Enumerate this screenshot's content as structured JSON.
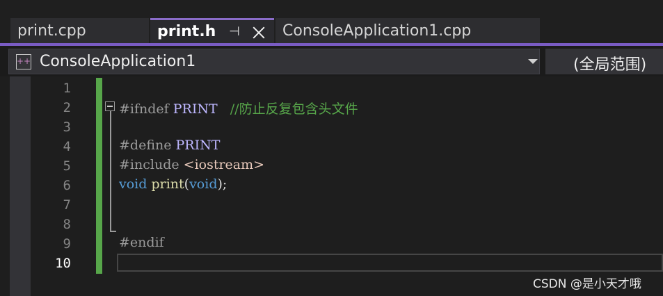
{
  "tabs": [
    {
      "label": "print.cpp"
    },
    {
      "label": "print.h"
    },
    {
      "label": "ConsoleApplication1.cpp"
    }
  ],
  "navbar": {
    "project": "ConsoleApplication1",
    "scope": "(全局范围)"
  },
  "editor": {
    "line_numbers": [
      "1",
      "2",
      "3",
      "4",
      "5",
      "6",
      "7",
      "8",
      "9",
      "10"
    ],
    "current_line": 10,
    "code": {
      "l2_directive": "#ifndef",
      "l2_macro": " PRINT",
      "l2_comment": "   //防止反复包含头文件",
      "l4_directive": "#define",
      "l4_macro": " PRINT",
      "l5_directive": "#include",
      "l5_header": " <iostream>",
      "l6_void1": "void",
      "l6_fn": " print",
      "l6_paren_open": "(",
      "l6_void2": "void",
      "l6_tail": ");",
      "l9_directive": "#endif"
    }
  },
  "watermark": "CSDN @是小天才哦",
  "colors": {
    "accent": "#7a5cc4",
    "change_bar": "#57a64a",
    "keyword": "#569cd6",
    "macro": "#beb7ff",
    "comment": "#57a64a",
    "function": "#dcdcaa"
  },
  "icons": {
    "pin": "pin-icon",
    "close": "close-icon",
    "project": "project-icon",
    "dropdown": "chevron-down-icon"
  }
}
